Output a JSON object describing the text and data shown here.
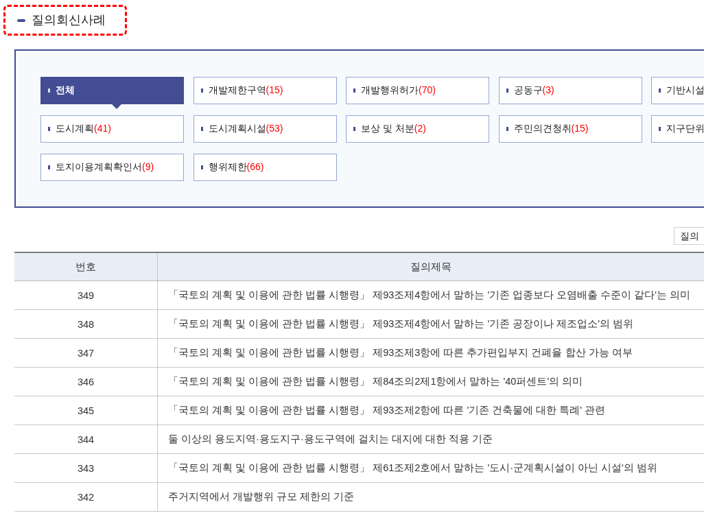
{
  "page_title": {
    "text": "질의회신사례",
    "highlighted": true
  },
  "categories": [
    {
      "label": "전체",
      "selected": true
    },
    {
      "label": "개발제한구역",
      "count": "(15)",
      "selected": false
    },
    {
      "label": "개발행위허가",
      "count": "(70)",
      "selected": false
    },
    {
      "label": "공동구",
      "count": "(3)",
      "selected": false
    },
    {
      "label": "기반시설",
      "selected": false
    },
    {
      "label": "도시계획",
      "count": "(41)",
      "selected": false
    },
    {
      "label": "도시계획시설",
      "count": "(53)",
      "selected": false
    },
    {
      "label": "보상 및 처분",
      "count": "(2)",
      "selected": false
    },
    {
      "label": "주민의견청취",
      "count": "(15)",
      "selected": false
    },
    {
      "label": "지구단위",
      "selected": false
    },
    {
      "label": "토지이용계획확인서",
      "count": "(9)",
      "selected": false
    },
    {
      "label": "행위제한",
      "count": "(66)",
      "selected": false
    }
  ],
  "search_type_select": {
    "value": "질의"
  },
  "table": {
    "columns": [
      "번호",
      "질의제목"
    ],
    "rows": [
      {
        "number": "349",
        "title": "「국토의 계획 및 이용에 관한 법률 시행령」 제93조제4항에서 말하는 '기존 업종보다 오염배출 수준이 같다'는 의미"
      },
      {
        "number": "348",
        "title": "「국토의 계획 및 이용에 관한 법률 시행령」 제93조제4항에서 말하는 '기존 공장이나 제조업소'의 범위"
      },
      {
        "number": "347",
        "title": "「국토의 계획 및 이용에 관한 법률 시행령」 제93조제3항에 따른 추가편입부지 건폐율 합산 가능 여부"
      },
      {
        "number": "346",
        "title": "「국토의 계획 및 이용에 관한 법률 시행령」 제84조의2제1항에서 말하는 '40퍼센트'의 의미"
      },
      {
        "number": "345",
        "title": "「국토의 계획 및 이용에 관한 법률 시행령」 제93조제2항에 따른 '기존 건축물에 대한 특례' 관련"
      },
      {
        "number": "344",
        "title": "둘 이상의 용도지역·용도지구·용도구역에 걸치는 대지에 대한 적용 기준"
      },
      {
        "number": "343",
        "title": "「국토의 계획 및 이용에 관한 법률 시행령」 제61조제2호에서 말하는 '도시·군계획시설이 아닌 시설'의 범위"
      },
      {
        "number": "342",
        "title": "주거지역에서 개발행위 규모 제한의 기준"
      }
    ]
  }
}
